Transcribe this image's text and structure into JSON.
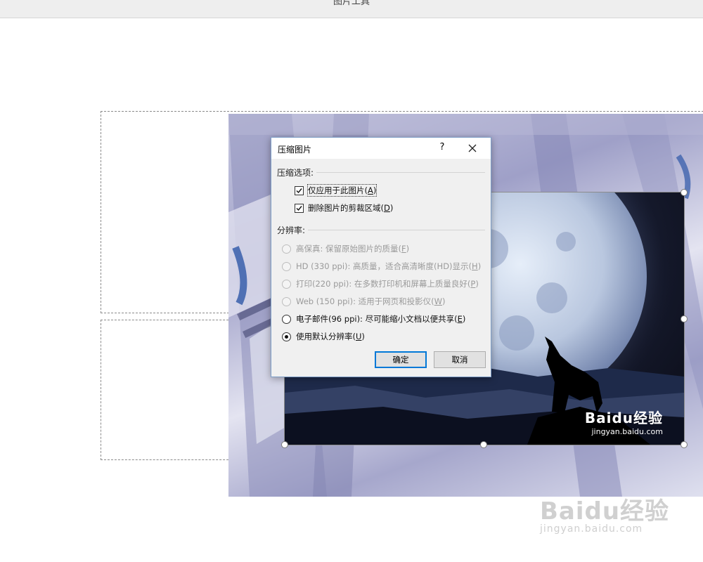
{
  "app": {
    "title": "图片工具"
  },
  "dialog": {
    "title": "压缩图片",
    "help_label": "?",
    "compress_section": "压缩选项:",
    "options": [
      {
        "label": "仅应用于此图片",
        "key": "A",
        "checked": true
      },
      {
        "label": "删除图片的剪裁区域",
        "key": "D",
        "checked": true
      }
    ],
    "resolution_section": "分辨率:",
    "resolutions": [
      {
        "label": "高保真: 保留原始图片的质量",
        "key": "F",
        "enabled": false,
        "selected": false
      },
      {
        "label": "HD (330 ppi): 高质量，适合高清晰度(HD)显示",
        "key": "H",
        "enabled": false,
        "selected": false
      },
      {
        "label": "打印(220 ppi): 在多数打印机和屏幕上质量良好",
        "key": "P",
        "enabled": false,
        "selected": false
      },
      {
        "label": "Web (150 ppi): 适用于网页和投影仪",
        "key": "W",
        "enabled": false,
        "selected": false
      },
      {
        "label": "电子邮件(96 ppi): 尽可能缩小文档以便共享",
        "key": "E",
        "enabled": true,
        "selected": false
      },
      {
        "label": "使用默认分辨率",
        "key": "U",
        "enabled": true,
        "selected": true
      }
    ],
    "ok_label": "确定",
    "cancel_label": "取消"
  },
  "watermark": {
    "brand": "Baidu经验",
    "url": "jingyan.baidu.com"
  }
}
